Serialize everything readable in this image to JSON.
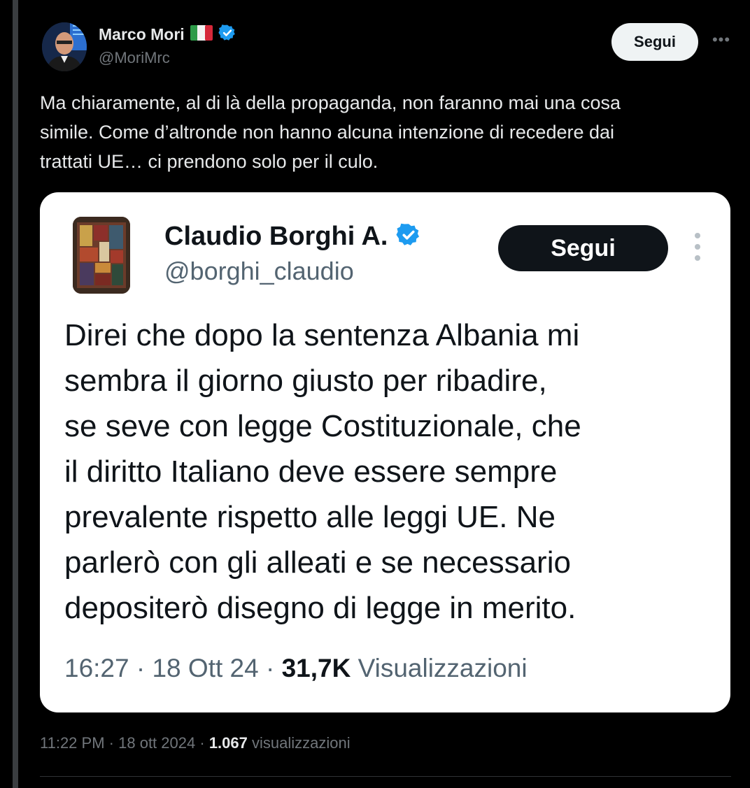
{
  "author": {
    "name": "Marco Mori",
    "handle": "@MoriMrc",
    "follow_label": "Segui",
    "more_label": "•••"
  },
  "tweet": {
    "text": "Ma chiaramente, al di là della propaganda, non faranno mai una cosa\nsimile. Come d’altronde non hanno alcuna intenzione di recedere dai\ntrattati UE… ci prendono solo per il culo."
  },
  "quoted": {
    "name": "Claudio Borghi A.",
    "handle": "@borghi_claudio",
    "follow_label": "Segui",
    "text": "Direi che dopo la sentenza Albania mi\nsembra il giorno giusto per ribadire,\nse seve con legge Costituzionale, che\nil diritto Italiano deve essere sempre\nprevalente rispetto alle leggi UE. Ne\nparlerò con gli alleati e se necessario\ndepositerò disegno di legge in merito.",
    "time": "16:27",
    "date": "18 Ott 24",
    "views_count": "31,7K",
    "views_label": "Visualizzazioni"
  },
  "meta": {
    "time": "11:22 PM",
    "date": "18 ott 2024",
    "views_count": "1.067",
    "views_label": "visualizzazioni"
  },
  "colors": {
    "verified": "#1d9bf0",
    "background": "#000000",
    "secondary_text": "#71767b"
  }
}
